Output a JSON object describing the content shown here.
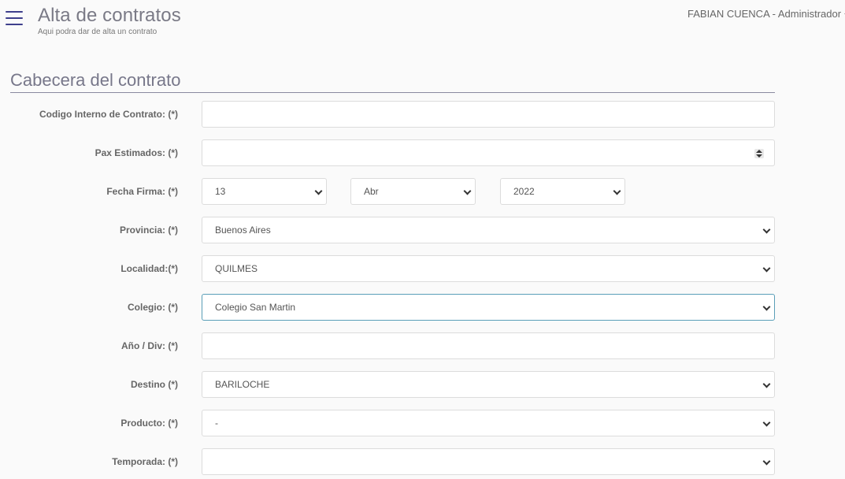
{
  "header": {
    "title": "Alta de contratos",
    "subtitle": "Aqui podra dar de alta un contrato",
    "user": "FABIAN CUENCA - Administrador"
  },
  "section": {
    "title": "Cabecera del contrato"
  },
  "form": {
    "codigo": {
      "label": "Codigo Interno de Contrato: (*)",
      "value": ""
    },
    "pax": {
      "label": "Pax Estimados: (*)",
      "value": ""
    },
    "fecha": {
      "label": "Fecha Firma: (*)",
      "day": "13",
      "month": "Abr",
      "year": "2022"
    },
    "provincia": {
      "label": "Provincia: (*)",
      "value": "Buenos Aires"
    },
    "localidad": {
      "label": "Localidad:(*)",
      "value": "QUILMES"
    },
    "colegio": {
      "label": "Colegio: (*)",
      "value": "Colegio San Martin"
    },
    "anio_div": {
      "label": "Año / Div: (*)",
      "value": ""
    },
    "destino": {
      "label": "Destino (*)",
      "value": "BARILOCHE"
    },
    "producto": {
      "label": "Producto: (*)",
      "value": "-"
    },
    "temporada": {
      "label": "Temporada: (*)",
      "value": ""
    }
  },
  "colors": {
    "accent": "#3e3f8c",
    "focus": "#5a9fb8"
  }
}
